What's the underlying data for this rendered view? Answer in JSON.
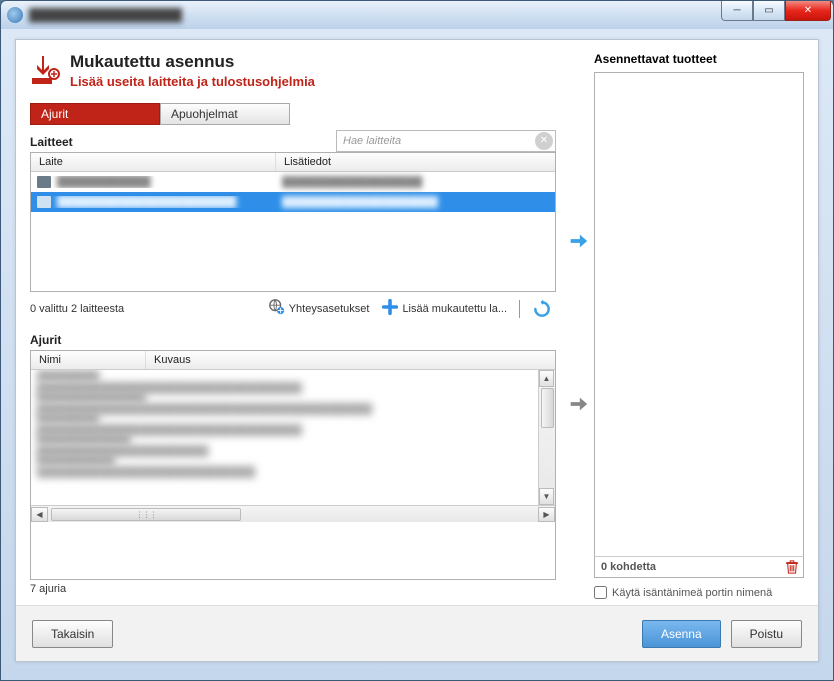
{
  "window": {
    "title": "██████████████████"
  },
  "header": {
    "title": "Mukautettu asennus",
    "subtitle": "Lisää useita laitteita ja tulostusohjelmia"
  },
  "tabs": {
    "drivers": "Ajurit",
    "utilities": "Apuohjelmat"
  },
  "devices": {
    "section_label": "Laitteet",
    "search_placeholder": "Hae laitteita",
    "col_device": "Laite",
    "col_info": "Lisätiedot",
    "rows": [
      {
        "name": "████████████",
        "info": "██████████████████",
        "selected": false
      },
      {
        "name": "███████████████████████",
        "info": "████████████████████",
        "selected": true
      }
    ],
    "status": "0 valittu 2 laitteesta"
  },
  "toolbar": {
    "connection": "Yhteysasetukset",
    "add_custom": "Lisää mukautettu la..."
  },
  "drivers": {
    "section_label": "Ajurit",
    "col_name": "Nimi",
    "col_desc": "Kuvaus",
    "rows": [
      {
        "name": "████████",
        "desc": "██████████████████████████████████"
      },
      {
        "name": "██████████████",
        "desc": "███████████████████████████████████████████"
      },
      {
        "name": "████████",
        "desc": "██████████████████████████████████"
      },
      {
        "name": "████████████",
        "desc": "██████████████████████"
      },
      {
        "name": "██████████",
        "desc": "████████████████████████████"
      }
    ],
    "count": "7 ajuria"
  },
  "right": {
    "label": "Asennettavat tuotteet",
    "count": "0 kohdetta",
    "checkbox": "Käytä isäntänimeä portin nimenä"
  },
  "footer": {
    "back": "Takaisin",
    "install": "Asenna",
    "exit": "Poistu"
  }
}
